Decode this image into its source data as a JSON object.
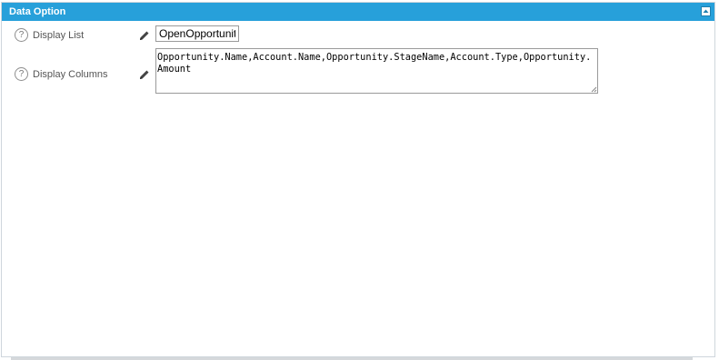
{
  "panel": {
    "title": "Data Option",
    "collapse_icon": "collapse-up-icon"
  },
  "fields": {
    "display_list": {
      "label": "Display List",
      "help": "?",
      "value": "OpenOpportunity"
    },
    "display_columns": {
      "label": "Display Columns",
      "help": "?",
      "value": "Opportunity.Name,Account.Name,Opportunity.StageName,Account.Type,Opportunity.Amount"
    }
  },
  "colors": {
    "header": "#27a0da",
    "border": "#cfd6dc"
  }
}
